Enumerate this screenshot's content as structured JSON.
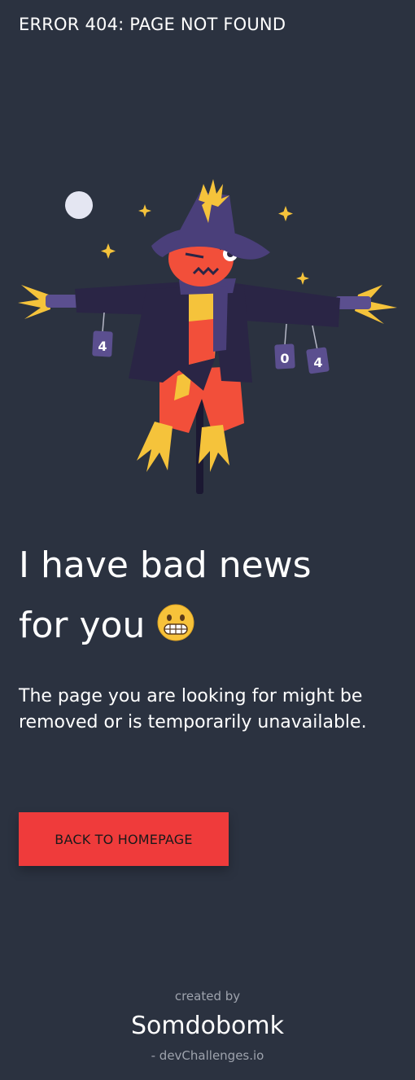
{
  "header": {
    "title": "ERROR 404: PAGE NOT FOUND"
  },
  "illustration": {
    "name": "scarecrow",
    "sign_digits": [
      "4",
      "0",
      "4"
    ]
  },
  "main": {
    "headline_line1": "I have bad news",
    "headline_line2": "for you",
    "emoji": "grimacing-face",
    "description": "The page you are looking for might be removed or is temporarily unavailable.",
    "button_label": "BACK TO HOMEPAGE"
  },
  "footer": {
    "created_by": "created by",
    "author": "Somdobomk",
    "site": "- devChallenges.io"
  },
  "colors": {
    "background": "#2b3240",
    "accent": "#ef3b3b",
    "hat": "#4a3f7a",
    "coat": "#2a2545",
    "straw": "#f5c33b",
    "face": "#f24f3a"
  }
}
